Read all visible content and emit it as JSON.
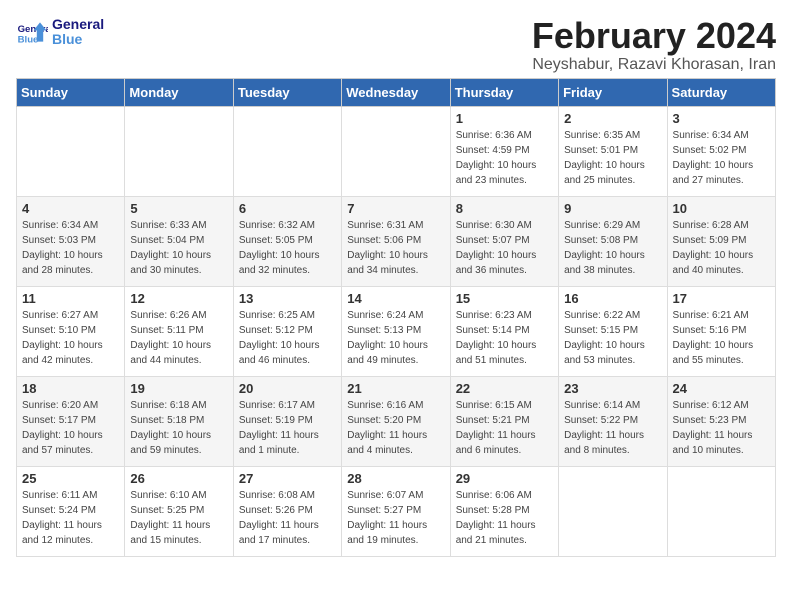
{
  "logo": {
    "general": "General",
    "blue": "Blue"
  },
  "title": "February 2024",
  "subtitle": "Neyshabur, Razavi Khorasan, Iran",
  "headers": [
    "Sunday",
    "Monday",
    "Tuesday",
    "Wednesday",
    "Thursday",
    "Friday",
    "Saturday"
  ],
  "weeks": [
    [
      {
        "day": "",
        "info": ""
      },
      {
        "day": "",
        "info": ""
      },
      {
        "day": "",
        "info": ""
      },
      {
        "day": "",
        "info": ""
      },
      {
        "day": "1",
        "info": "Sunrise: 6:36 AM\nSunset: 4:59 PM\nDaylight: 10 hours\nand 23 minutes."
      },
      {
        "day": "2",
        "info": "Sunrise: 6:35 AM\nSunset: 5:01 PM\nDaylight: 10 hours\nand 25 minutes."
      },
      {
        "day": "3",
        "info": "Sunrise: 6:34 AM\nSunset: 5:02 PM\nDaylight: 10 hours\nand 27 minutes."
      }
    ],
    [
      {
        "day": "4",
        "info": "Sunrise: 6:34 AM\nSunset: 5:03 PM\nDaylight: 10 hours\nand 28 minutes."
      },
      {
        "day": "5",
        "info": "Sunrise: 6:33 AM\nSunset: 5:04 PM\nDaylight: 10 hours\nand 30 minutes."
      },
      {
        "day": "6",
        "info": "Sunrise: 6:32 AM\nSunset: 5:05 PM\nDaylight: 10 hours\nand 32 minutes."
      },
      {
        "day": "7",
        "info": "Sunrise: 6:31 AM\nSunset: 5:06 PM\nDaylight: 10 hours\nand 34 minutes."
      },
      {
        "day": "8",
        "info": "Sunrise: 6:30 AM\nSunset: 5:07 PM\nDaylight: 10 hours\nand 36 minutes."
      },
      {
        "day": "9",
        "info": "Sunrise: 6:29 AM\nSunset: 5:08 PM\nDaylight: 10 hours\nand 38 minutes."
      },
      {
        "day": "10",
        "info": "Sunrise: 6:28 AM\nSunset: 5:09 PM\nDaylight: 10 hours\nand 40 minutes."
      }
    ],
    [
      {
        "day": "11",
        "info": "Sunrise: 6:27 AM\nSunset: 5:10 PM\nDaylight: 10 hours\nand 42 minutes."
      },
      {
        "day": "12",
        "info": "Sunrise: 6:26 AM\nSunset: 5:11 PM\nDaylight: 10 hours\nand 44 minutes."
      },
      {
        "day": "13",
        "info": "Sunrise: 6:25 AM\nSunset: 5:12 PM\nDaylight: 10 hours\nand 46 minutes."
      },
      {
        "day": "14",
        "info": "Sunrise: 6:24 AM\nSunset: 5:13 PM\nDaylight: 10 hours\nand 49 minutes."
      },
      {
        "day": "15",
        "info": "Sunrise: 6:23 AM\nSunset: 5:14 PM\nDaylight: 10 hours\nand 51 minutes."
      },
      {
        "day": "16",
        "info": "Sunrise: 6:22 AM\nSunset: 5:15 PM\nDaylight: 10 hours\nand 53 minutes."
      },
      {
        "day": "17",
        "info": "Sunrise: 6:21 AM\nSunset: 5:16 PM\nDaylight: 10 hours\nand 55 minutes."
      }
    ],
    [
      {
        "day": "18",
        "info": "Sunrise: 6:20 AM\nSunset: 5:17 PM\nDaylight: 10 hours\nand 57 minutes."
      },
      {
        "day": "19",
        "info": "Sunrise: 6:18 AM\nSunset: 5:18 PM\nDaylight: 10 hours\nand 59 minutes."
      },
      {
        "day": "20",
        "info": "Sunrise: 6:17 AM\nSunset: 5:19 PM\nDaylight: 11 hours\nand 1 minute."
      },
      {
        "day": "21",
        "info": "Sunrise: 6:16 AM\nSunset: 5:20 PM\nDaylight: 11 hours\nand 4 minutes."
      },
      {
        "day": "22",
        "info": "Sunrise: 6:15 AM\nSunset: 5:21 PM\nDaylight: 11 hours\nand 6 minutes."
      },
      {
        "day": "23",
        "info": "Sunrise: 6:14 AM\nSunset: 5:22 PM\nDaylight: 11 hours\nand 8 minutes."
      },
      {
        "day": "24",
        "info": "Sunrise: 6:12 AM\nSunset: 5:23 PM\nDaylight: 11 hours\nand 10 minutes."
      }
    ],
    [
      {
        "day": "25",
        "info": "Sunrise: 6:11 AM\nSunset: 5:24 PM\nDaylight: 11 hours\nand 12 minutes."
      },
      {
        "day": "26",
        "info": "Sunrise: 6:10 AM\nSunset: 5:25 PM\nDaylight: 11 hours\nand 15 minutes."
      },
      {
        "day": "27",
        "info": "Sunrise: 6:08 AM\nSunset: 5:26 PM\nDaylight: 11 hours\nand 17 minutes."
      },
      {
        "day": "28",
        "info": "Sunrise: 6:07 AM\nSunset: 5:27 PM\nDaylight: 11 hours\nand 19 minutes."
      },
      {
        "day": "29",
        "info": "Sunrise: 6:06 AM\nSunset: 5:28 PM\nDaylight: 11 hours\nand 21 minutes."
      },
      {
        "day": "",
        "info": ""
      },
      {
        "day": "",
        "info": ""
      }
    ]
  ]
}
